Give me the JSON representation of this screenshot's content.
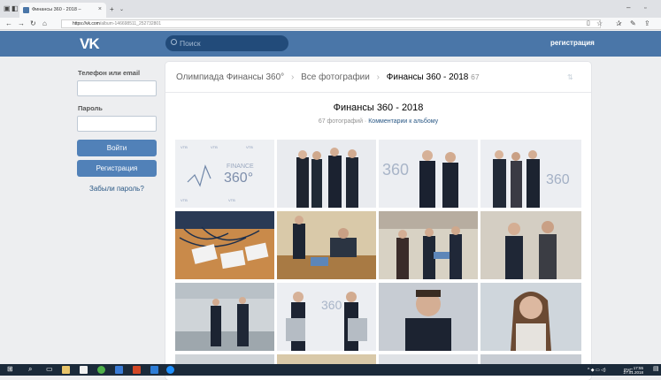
{
  "browser": {
    "tab_title": "Финансы 360 - 2018 –",
    "url_host": "https://vk.com",
    "url_path": "/album-146698511_252732801"
  },
  "header": {
    "logo": "VK",
    "search_placeholder": "Поиск",
    "signup_link": "регистрация"
  },
  "login": {
    "phone_label": "Телефон или email",
    "password_label": "Пароль",
    "login_button": "Войти",
    "register_button": "Регистрация",
    "forgot_link": "Забыли пароль?"
  },
  "album": {
    "breadcrumb_group": "Олимпиада Финансы 360°",
    "breadcrumb_all": "Все фотографии",
    "breadcrumb_current": "Финансы 360 - 2018",
    "breadcrumb_count": "67",
    "title": "Финансы 360 - 2018",
    "photo_count": "67 фотографий",
    "comments_link": "Комментарии к альбому"
  },
  "taskbar": {
    "lang": "РУС",
    "time": "17:55",
    "date": "27.01.2018"
  },
  "colors": {
    "vk_blue": "#4a76a8",
    "button_blue": "#5181b8",
    "page_bg": "#edeef0"
  }
}
